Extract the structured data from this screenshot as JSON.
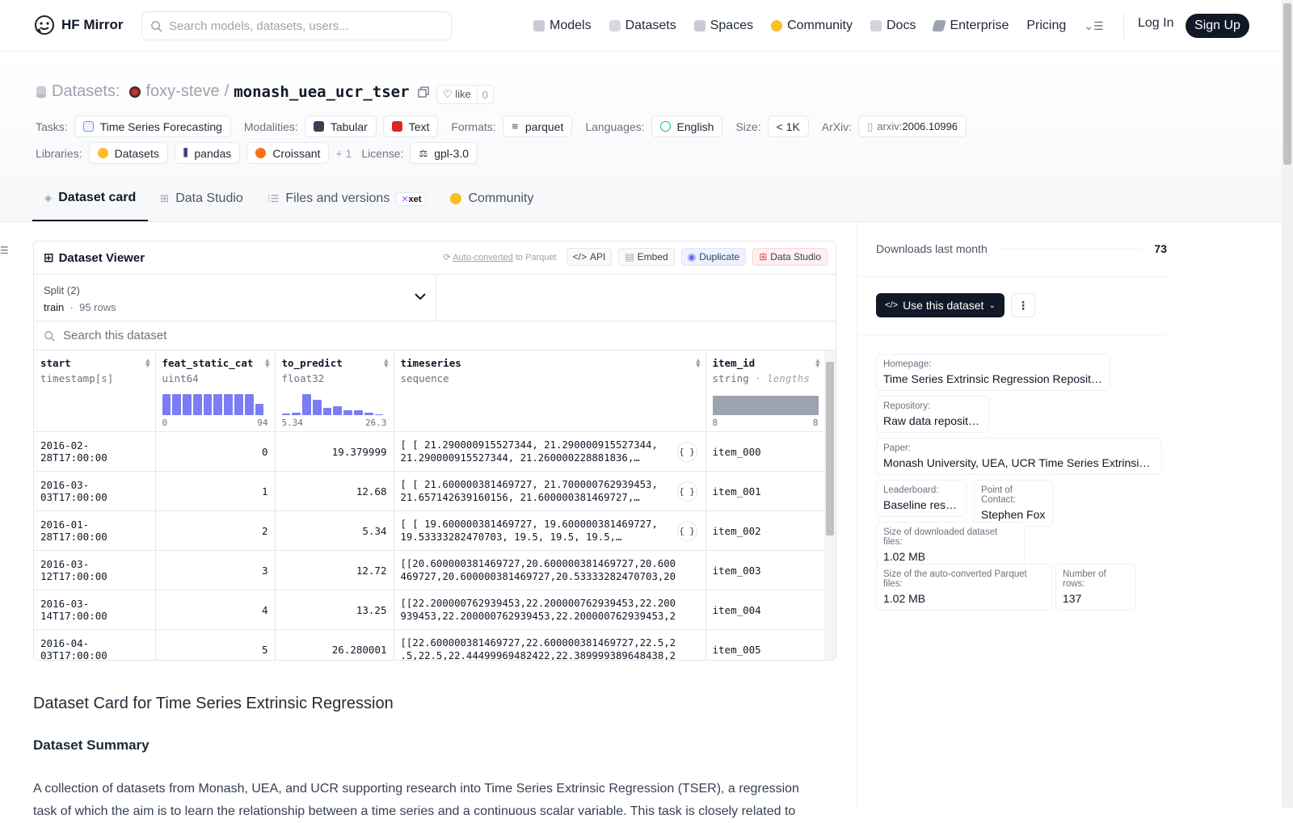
{
  "nav": {
    "brand": "HF Mirror",
    "search_placeholder": "Search models, datasets, users...",
    "links": [
      "Models",
      "Datasets",
      "Spaces",
      "Community",
      "Docs",
      "Enterprise",
      "Pricing"
    ],
    "login": "Log In",
    "signup": "Sign Up"
  },
  "header": {
    "datasets_label": "Datasets:",
    "owner": "foxy-steve",
    "sep": "/",
    "repo": "monash_uea_ucr_tser",
    "like_label": "like",
    "like_count": "0",
    "tasks_label": "Tasks:",
    "task": "Time Series Forecasting",
    "modalities_label": "Modalities:",
    "modalities": [
      "Tabular",
      "Text"
    ],
    "formats_label": "Formats:",
    "format": "parquet",
    "languages_label": "Languages:",
    "language": "English",
    "size_label": "Size:",
    "size": "< 1K",
    "arxiv_label": "ArXiv:",
    "arxiv_prefix": "arxiv:",
    "arxiv_id": "2006.10996",
    "libraries_label": "Libraries:",
    "libraries": [
      "Datasets",
      "pandas",
      "Croissant"
    ],
    "more_libs": "+ 1",
    "license_label": "License:",
    "license": "gpl-3.0"
  },
  "tabs": [
    "Dataset card",
    "Data Studio",
    "Files and versions",
    "Community"
  ],
  "xet": "xet",
  "viewer": {
    "title": "Dataset Viewer",
    "auto_converted": "Auto-converted",
    "to_parquet": "to Parquet",
    "buttons": [
      "API",
      "Embed",
      "Duplicate",
      "Data Studio"
    ],
    "split_label": "Split (2)",
    "split_name": "train",
    "split_rows": "95 rows",
    "search_placeholder": "Search this dataset",
    "columns": [
      {
        "name": "start",
        "type": "timestamp[s]"
      },
      {
        "name": "feat_static_cat",
        "type": "uint64",
        "min": "0",
        "max": "94"
      },
      {
        "name": "to_predict",
        "type": "float32",
        "min": "5.34",
        "max": "26.3"
      },
      {
        "name": "timeseries",
        "type": "sequence"
      },
      {
        "name": "item_id",
        "type": "string",
        "type_note": "lengths",
        "min": "8",
        "max": "8"
      }
    ],
    "hist_feat": [
      1,
      1,
      1,
      1,
      1,
      1,
      1,
      1,
      1,
      0.55
    ],
    "hist_pred": [
      0.08,
      0.1,
      1,
      0.75,
      0.35,
      0.42,
      0.25,
      0.25,
      0.13,
      0.05
    ],
    "rows": [
      {
        "start": "2016-02-28T17:00:00",
        "cat": "0",
        "pred": "19.379999",
        "ts1": "[ [ 21.290000915527344, 21.290000915527344,",
        "ts2": "21.290000915527344, 21.260000228881836,…",
        "item": "item_000",
        "json": true
      },
      {
        "start": "2016-03-03T17:00:00",
        "cat": "1",
        "pred": "12.68",
        "ts1": "[ [ 21.600000381469727, 21.700000762939453,",
        "ts2": "21.657142639160156, 21.600000381469727,…",
        "item": "item_001",
        "json": true
      },
      {
        "start": "2016-01-28T17:00:00",
        "cat": "2",
        "pred": "5.34",
        "ts1": "[ [ 19.600000381469727, 19.600000381469727,",
        "ts2": "19.53333282470703, 19.5, 19.5, 19.5,…",
        "item": "item_002",
        "json": true
      },
      {
        "start": "2016-03-12T17:00:00",
        "cat": "3",
        "pred": "12.72",
        "ts1": "[[20.600000381469727,20.600000381469727,20.600000381",
        "ts2": "469727,20.600000381469727,20.53333282470703,20.5(..…",
        "item": "item_003",
        "json": false
      },
      {
        "start": "2016-03-14T17:00:00",
        "cat": "4",
        "pred": "13.25",
        "ts1": "[[22.200000762939453,22.200000762939453,22.200000762",
        "ts2": "939453,22.200000762939453,22.200000762939453,22.…",
        "item": "item_004",
        "json": false
      },
      {
        "start": "2016-04-03T17:00:00",
        "cat": "5",
        "pred": "26.280001",
        "ts1": "[[22.600000381469727,22.600000381469727,22.5,22.5,22",
        "ts2": ".5,22.5,22.44499969482422,22.389999389648438,22.…",
        "item": "item_005",
        "json": false
      }
    ]
  },
  "card": {
    "h2": "Dataset Card for Time Series Extrinsic Regression",
    "h3": "Dataset Summary",
    "para": "A collection of datasets from Monash, UEA, and UCR supporting research into Time Series Extrinsic Regression (TSER), a regression task of which the aim is to learn the relationship between a time series and a continuous scalar variable. This task is closely related to"
  },
  "sidebar": {
    "downloads_label": "Downloads last month",
    "downloads": "73",
    "use_dataset": "Use this dataset",
    "info": [
      {
        "k": "Homepage:",
        "v": "Time Series Extrinsic Regression Repository"
      },
      {
        "k": "Repository:",
        "v": "Raw data repository"
      },
      {
        "k": "Paper:",
        "v": "Monash University, UEA, UCR Time Series Extrinsic Re…"
      },
      {
        "k": "Leaderboard:",
        "v": "Baseline results"
      },
      {
        "k": "Point of Contact:",
        "v": "Stephen Fox"
      },
      {
        "k": "Size of downloaded dataset files:",
        "v": "1.02 MB"
      },
      {
        "k": "Size of the auto-converted Parquet files:",
        "v": "1.02 MB"
      },
      {
        "k": "Number of rows:",
        "v": "137"
      }
    ]
  }
}
